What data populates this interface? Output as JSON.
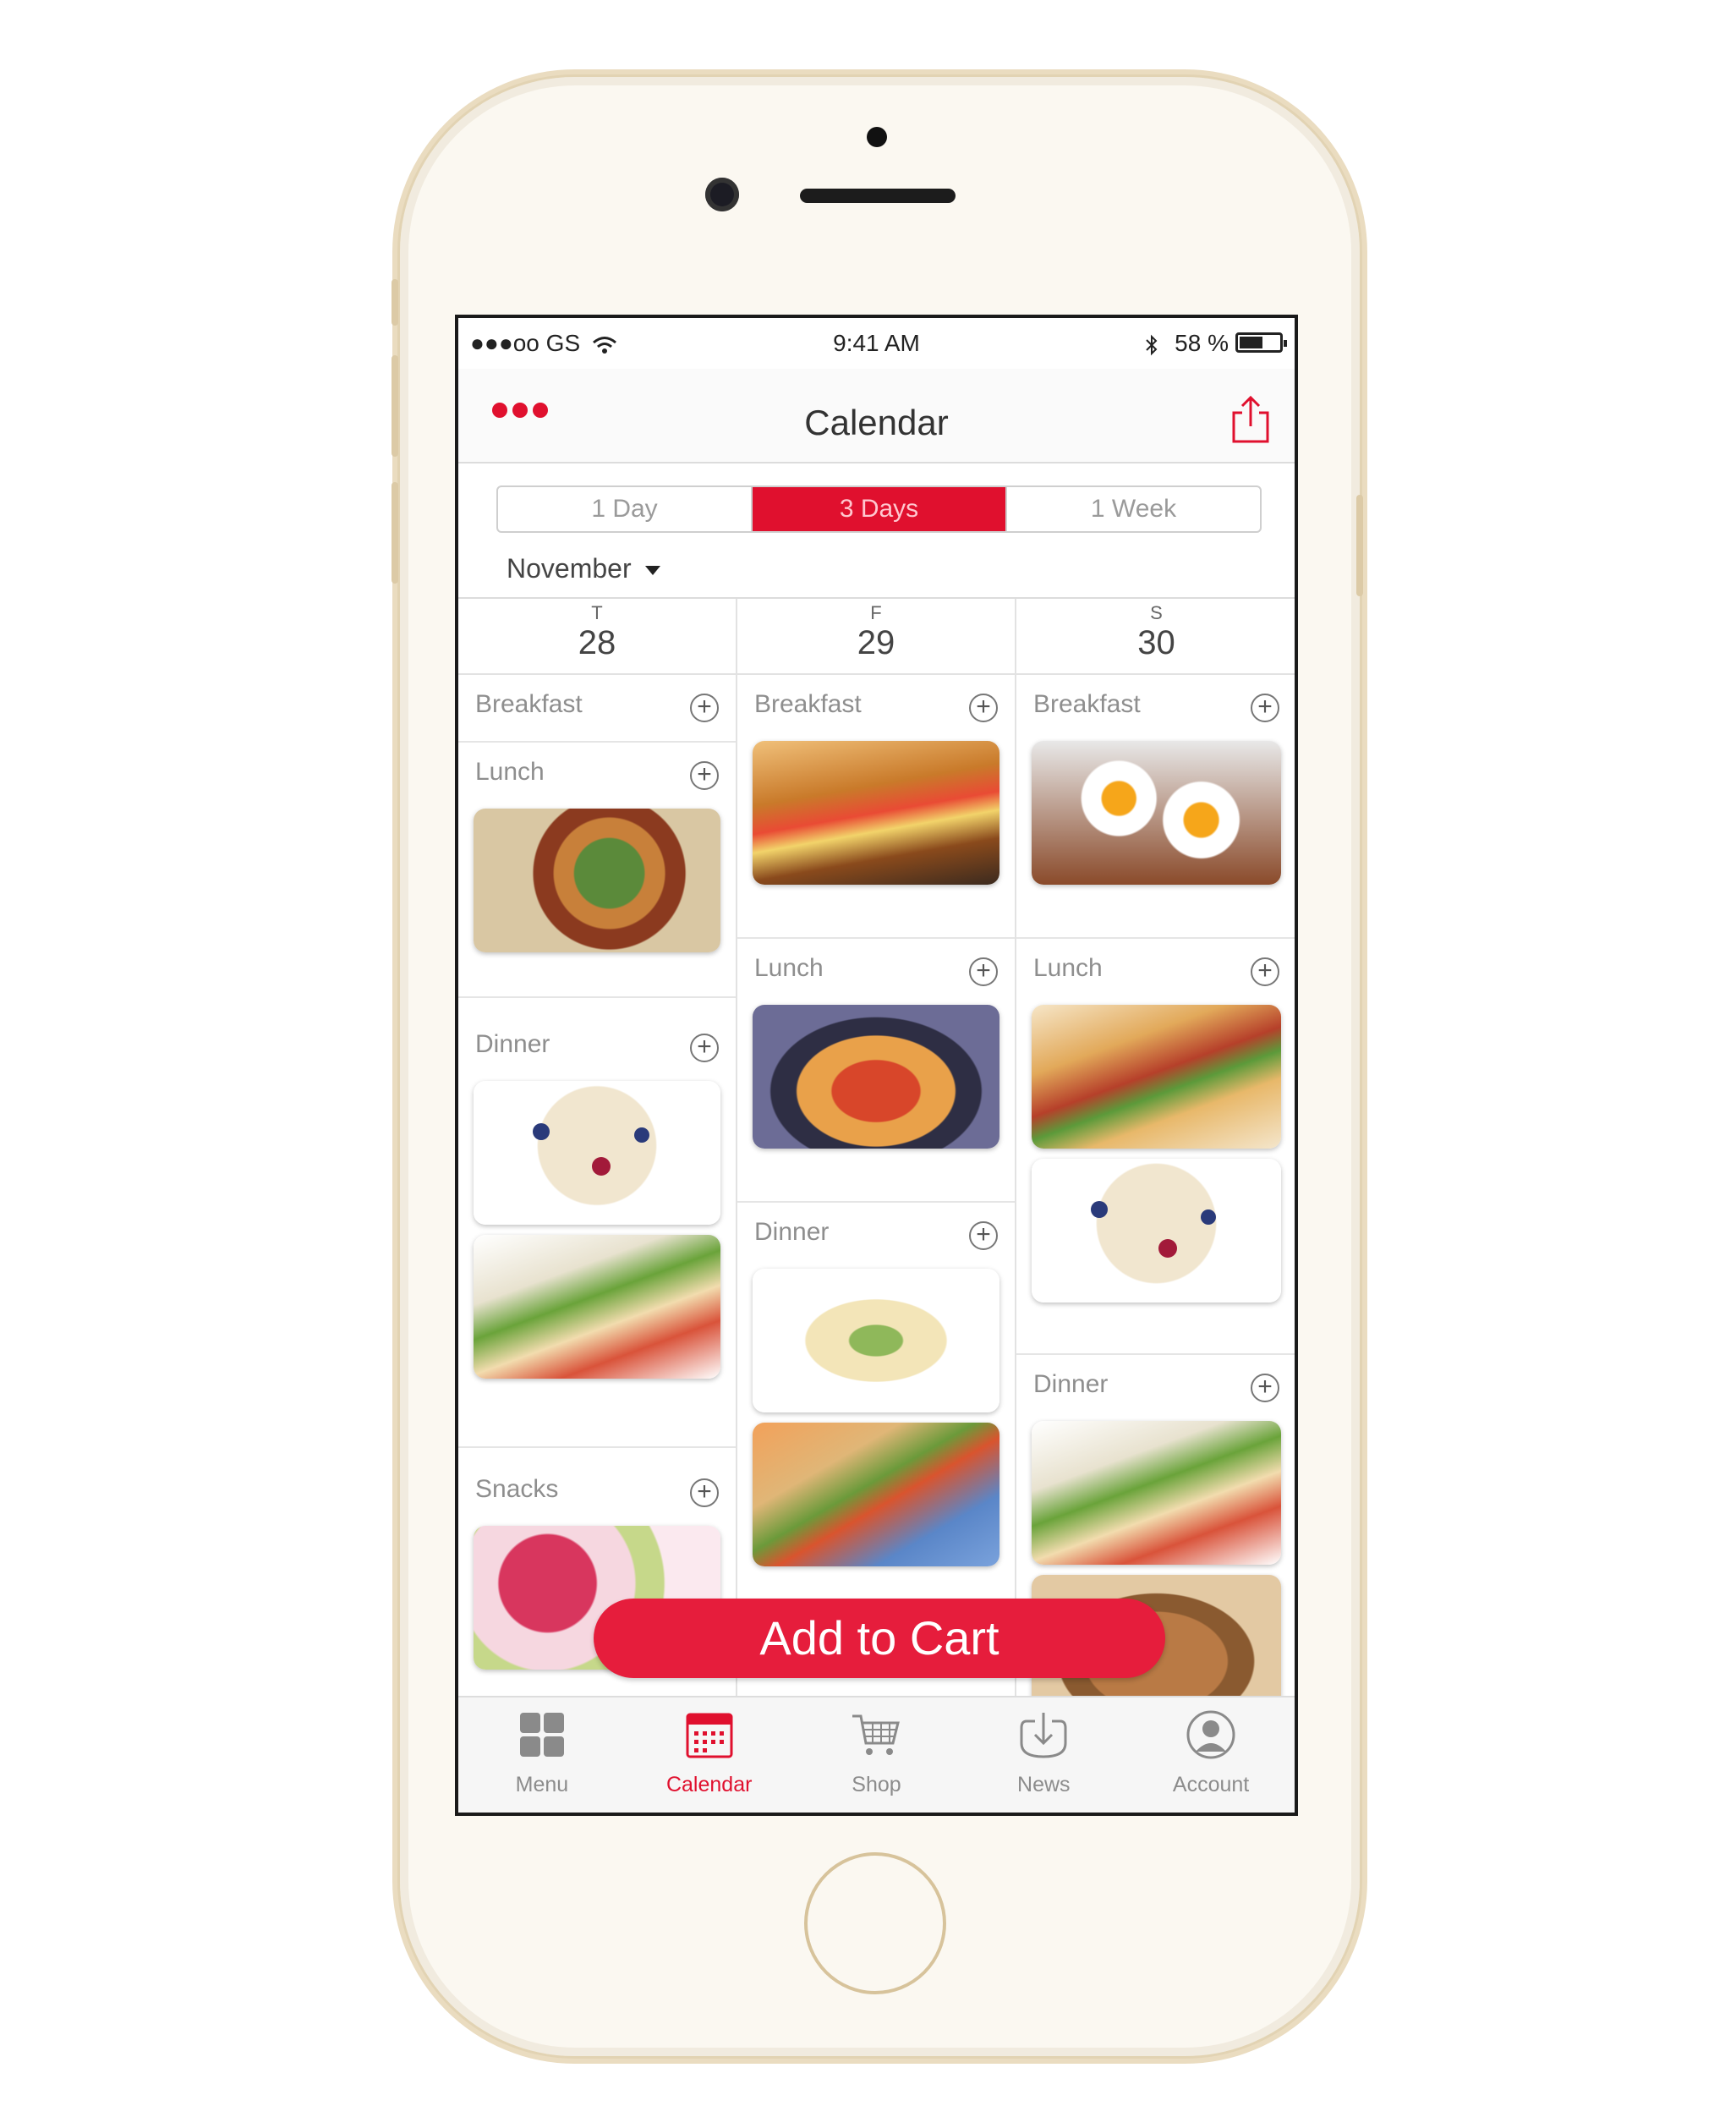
{
  "status_bar": {
    "carrier": "●●●oo GS",
    "time": "9:41 AM",
    "battery_text": "58 %",
    "battery_level": 0.58
  },
  "nav": {
    "title": "Calendar",
    "menu_icon": "three-dots-icon",
    "share_icon": "share-icon"
  },
  "range_selector": {
    "options": [
      "1 Day",
      "3 Days",
      "1 Week"
    ],
    "selected": "3 Days"
  },
  "month": "November",
  "days": [
    {
      "weekday": "T",
      "date": "28",
      "meals": [
        {
          "label": "Breakfast",
          "items": []
        },
        {
          "label": "Lunch",
          "items": [
            "chicken-vegetable-stirfry"
          ]
        },
        {
          "label": "Dinner",
          "items": [
            "berry-oatmeal",
            "veggie-wraps"
          ]
        },
        {
          "label": "Snacks",
          "items": [
            "raspberry-yogurt"
          ]
        }
      ]
    },
    {
      "weekday": "F",
      "date": "29",
      "meals": [
        {
          "label": "Breakfast",
          "items": [
            "croissant-sandwich"
          ]
        },
        {
          "label": "Lunch",
          "items": [
            "spaghetti-tomato"
          ]
        },
        {
          "label": "Dinner",
          "items": [
            "asparagus-crepes",
            "hotdog-buns"
          ]
        }
      ]
    },
    {
      "weekday": "S",
      "date": "30",
      "meals": [
        {
          "label": "Breakfast",
          "items": [
            "egg-avocado-toast"
          ]
        },
        {
          "label": "Lunch",
          "items": [
            "ham-baguette",
            "berry-oatmeal"
          ]
        },
        {
          "label": "Dinner",
          "items": [
            "veggie-wraps",
            "almonds"
          ]
        }
      ]
    }
  ],
  "add_to_cart": "Add to Cart",
  "tabs": [
    {
      "label": "Menu",
      "icon": "grid-icon",
      "active": false
    },
    {
      "label": "Calendar",
      "icon": "calendar-icon",
      "active": true
    },
    {
      "label": "Shop",
      "icon": "cart-icon",
      "active": false
    },
    {
      "label": "News",
      "icon": "download-icon",
      "active": false
    },
    {
      "label": "Account",
      "icon": "user-icon",
      "active": false
    }
  ],
  "colors": {
    "accent": "#e0102e",
    "button": "#e61d3c"
  }
}
